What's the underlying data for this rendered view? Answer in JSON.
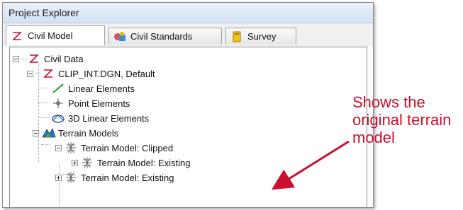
{
  "window": {
    "title": "Project Explorer"
  },
  "tabs": [
    {
      "label": "Civil Model",
      "icon": "civil-z-icon",
      "active": true
    },
    {
      "label": "Civil Standards",
      "icon": "civil-standards-icon",
      "active": false
    },
    {
      "label": "Survey",
      "icon": "survey-book-icon",
      "active": false
    }
  ],
  "tree": {
    "civil_data": "Civil Data",
    "file": "CLIP_INT.DGN, Default",
    "linear": "Linear Elements",
    "point": "Point Elements",
    "linear3d": "3D Linear Elements",
    "terrain_models": "Terrain Models",
    "clipped": "Terrain Model: Clipped",
    "existing_child": "Terrain Model: Existing",
    "existing": "Terrain Model: Existing"
  },
  "callout": {
    "text": "Shows the original terrain model",
    "color": "#c8102e"
  },
  "colors": {
    "accent": "#c8102e",
    "title_bg": "#d3e1f2"
  }
}
